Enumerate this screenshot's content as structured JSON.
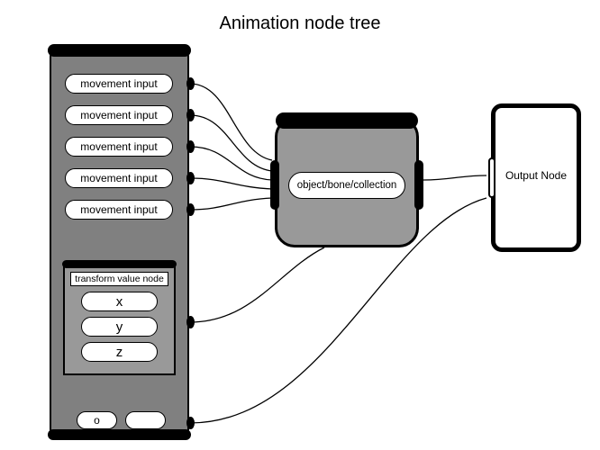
{
  "title": "Animation node tree",
  "leftPanel": {
    "inputs": [
      "movement input",
      "movement input",
      "movement input",
      "movement input",
      "movement input"
    ],
    "transform": {
      "label": "transform value node",
      "axes": [
        "x",
        "y",
        "z"
      ]
    },
    "bottomButtons": [
      "o",
      ""
    ]
  },
  "middleNode": {
    "label": "object/bone/collection"
  },
  "rightNode": {
    "label": "Output Node"
  }
}
